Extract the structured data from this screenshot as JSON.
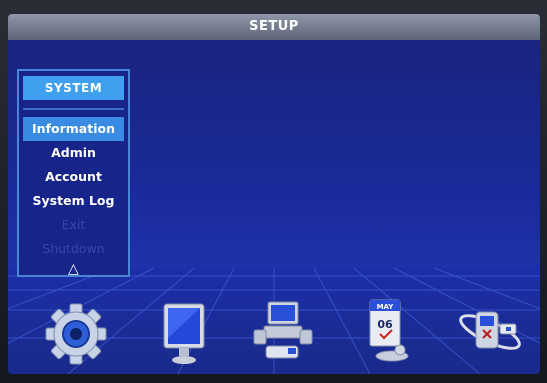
{
  "window": {
    "title": "SETUP"
  },
  "menu": {
    "header": "SYSTEM",
    "items": [
      {
        "label": "Information",
        "state": "selected"
      },
      {
        "label": "Admin",
        "state": "normal"
      },
      {
        "label": "Account",
        "state": "normal"
      },
      {
        "label": "System Log",
        "state": "normal"
      },
      {
        "label": "Exit",
        "state": "disabled"
      },
      {
        "label": "Shutdown",
        "state": "disabled"
      }
    ],
    "scroll_indicator": "△"
  },
  "icons": [
    {
      "name": "gear-icon",
      "label": "System"
    },
    {
      "name": "monitor-icon",
      "label": "Display"
    },
    {
      "name": "computer-network-icon",
      "label": "Network"
    },
    {
      "name": "calendar-icon",
      "label": "Schedule",
      "month": "MAY",
      "day": "06"
    },
    {
      "name": "storage-icon",
      "label": "Storage"
    }
  ],
  "colors": {
    "background": "#1a2a9a",
    "accent": "#3fa0f0",
    "selected": "#3a8ce2",
    "title_bar": "#7880a0"
  }
}
